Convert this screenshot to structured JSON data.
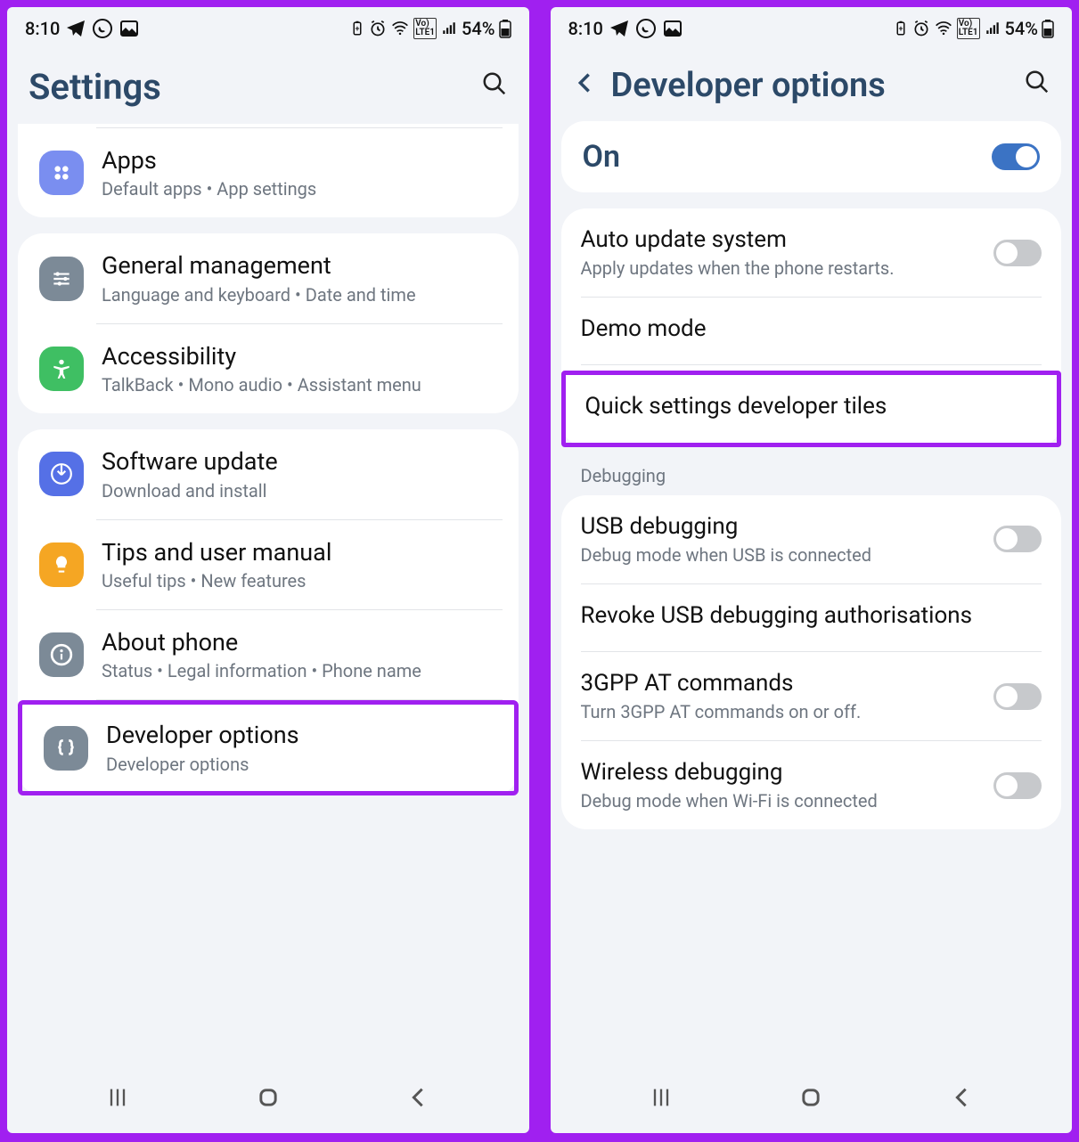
{
  "status": {
    "time": "8:10",
    "battery_pct": "54%"
  },
  "left": {
    "header_title": "Settings",
    "cards": [
      {
        "rows": [
          {
            "icon_bg": "#7a8ef0",
            "icon_name": "apps-icon",
            "title": "Apps",
            "sub": "Default apps  •  App settings"
          }
        ]
      },
      {
        "rows": [
          {
            "icon_bg": "#7c8a97",
            "icon_name": "settings-sliders-icon",
            "title": "General management",
            "sub": "Language and keyboard  •  Date and time"
          },
          {
            "icon_bg": "#3fbf63",
            "icon_name": "accessibility-icon",
            "title": "Accessibility",
            "sub": "TalkBack  •  Mono audio  •  Assistant menu"
          }
        ]
      },
      {
        "rows": [
          {
            "icon_bg": "#5570e6",
            "icon_name": "download-icon",
            "title": "Software update",
            "sub": "Download and install"
          },
          {
            "icon_bg": "#f5a623",
            "icon_name": "lightbulb-icon",
            "title": "Tips and user manual",
            "sub": "Useful tips  •  New features"
          },
          {
            "icon_bg": "#7c8a97",
            "icon_name": "info-icon",
            "title": "About phone",
            "sub": "Status  •  Legal information  •  Phone name"
          },
          {
            "icon_bg": "#7c8a97",
            "icon_name": "braces-icon",
            "title": "Developer options",
            "sub": "Developer options",
            "highlight": true
          }
        ]
      }
    ]
  },
  "right": {
    "header_title": "Developer options",
    "master_label": "On",
    "master_on": true,
    "rows1": [
      {
        "title": "Auto update system",
        "sub": "Apply updates when the phone restarts.",
        "toggle": false
      },
      {
        "title": "Demo mode"
      },
      {
        "title": "Quick settings developer tiles",
        "highlight": true
      }
    ],
    "section_header": "Debugging",
    "rows2": [
      {
        "title": "USB debugging",
        "sub": "Debug mode when USB is connected",
        "toggle": false
      },
      {
        "title": "Revoke USB debugging authorisations"
      },
      {
        "title": "3GPP AT commands",
        "sub": "Turn 3GPP AT commands on or off.",
        "toggle": false
      },
      {
        "title": "Wireless debugging",
        "sub": "Debug mode when Wi-Fi is connected",
        "toggle": false
      }
    ]
  }
}
